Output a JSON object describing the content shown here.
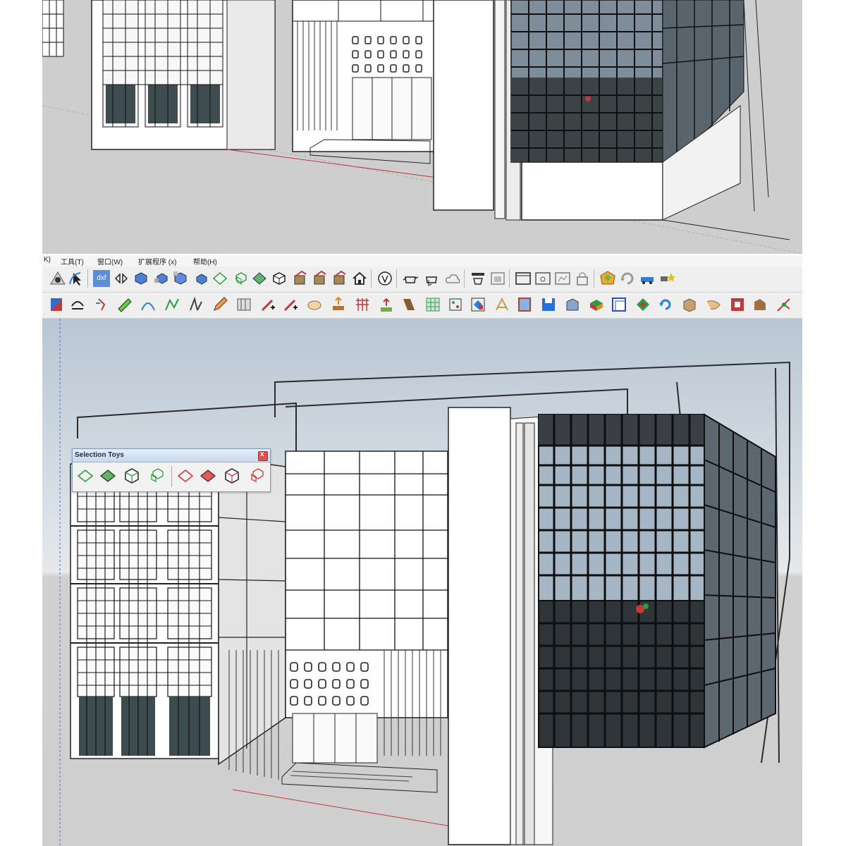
{
  "menu": {
    "items": [
      "K)",
      "工具(T)",
      "窗口(W)",
      "扩展程序 (x)",
      "帮助(H)"
    ]
  },
  "toolbars": {
    "row1_icons": [
      "orbit-eye-icon",
      "select-arrow-icon",
      "dxf-export-icon",
      "move-arrows-icon",
      "cube-icon",
      "cube-icon",
      "cube-icon",
      "cube-icon",
      "select-outline-icon",
      "select-cube-icon",
      "select-solid-icon",
      "select-cube-icon",
      "paint-icon",
      "paint-icon",
      "paint-icon",
      "house-icon",
      "vray-icon",
      "teapot-icon",
      "cloud-icon",
      "render-icon",
      "window-icon",
      "lock-icon",
      "gem-icon",
      "refresh-icon",
      "car-icon"
    ],
    "row2_icons": [
      "flag-icon",
      "arc-icon",
      "tool-icon",
      "ruler-icon",
      "curve-icon",
      "line-icon",
      "shape-icon",
      "pencil-icon",
      "pencil-plus-icon",
      "hand-icon",
      "grid-icon",
      "arrow-icon",
      "cube-color-icon",
      "window-icon",
      "save-icon",
      "building-icon",
      "box-icon",
      "layer-icon",
      "rotate-icon",
      "pipe-icon",
      "star-icon"
    ],
    "dxf_label": "dxf"
  },
  "selection_toys": {
    "title": "Selection Toys",
    "close_label": "x",
    "buttons": [
      "select-edges-icon",
      "select-faces-icon",
      "select-groups-icon",
      "select-components-icon",
      "deselect-edges-icon",
      "deselect-faces-icon",
      "deselect-groups-icon",
      "deselect-components-icon"
    ]
  },
  "colors": {
    "accent": "#2a7de1",
    "glass_dark": "#2d3236",
    "glass_light": "#a9b8c6",
    "axis_red": "#c03a3a",
    "axis_blue": "#4a6fd6"
  }
}
